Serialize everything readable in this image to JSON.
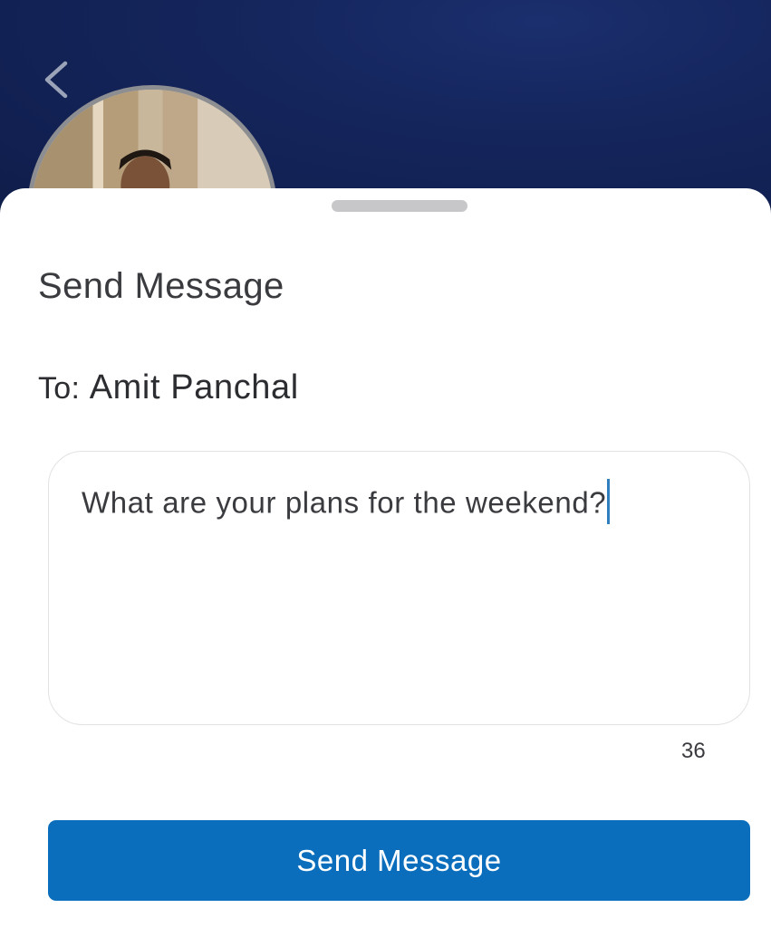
{
  "header": {
    "back_icon": "chevron-left-icon",
    "background_color": "#15265e"
  },
  "avatar": {
    "icon": "profile-photo"
  },
  "sheet": {
    "title": "Send Message",
    "recipient_prefix": "To:",
    "recipient_name": "Amit Panchal",
    "message_value": "What are your plans for the weekend?",
    "char_count": "36",
    "send_label": "Send Message",
    "accent_color": "#0a6ebd"
  }
}
